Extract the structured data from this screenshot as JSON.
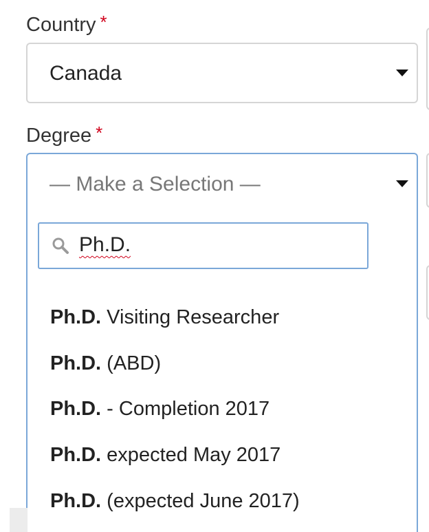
{
  "country": {
    "label": "Country",
    "required_mark": "*",
    "selected": "Canada"
  },
  "degree": {
    "label": "Degree",
    "required_mark": "*",
    "placeholder": "— Make a Selection —",
    "search": {
      "value": "Ph.D."
    },
    "options": [
      {
        "match": "Ph.D.",
        "rest": " Visiting Researcher"
      },
      {
        "match": "Ph.D.",
        "rest": " (ABD)"
      },
      {
        "match": "Ph.D.",
        "rest": " - Completion 2017"
      },
      {
        "match": "Ph.D.",
        "rest": " expected May 2017"
      },
      {
        "match": "Ph.D.",
        "rest": " (expected June 2017)"
      }
    ]
  },
  "colors": {
    "required": "#d0021b",
    "focus_border": "#7aa7d8",
    "border": "#d5d5d5"
  },
  "icons": [
    "search-icon",
    "caret-down-icon"
  ]
}
